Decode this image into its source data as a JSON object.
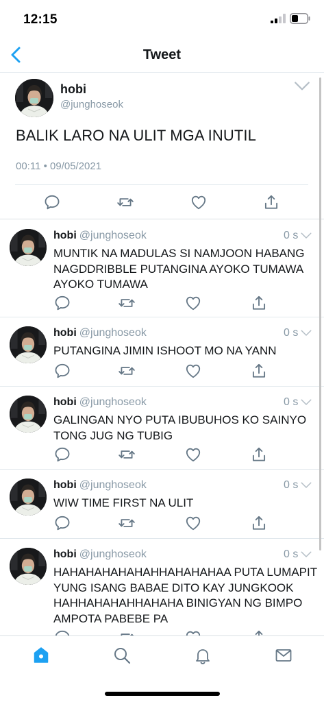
{
  "status_bar": {
    "time": "12:15"
  },
  "nav": {
    "title": "Tweet"
  },
  "main_tweet": {
    "name": "hobi",
    "handle": "@junghoseok",
    "text": "BALIK LARO NA ULIT MGA INUTIL",
    "meta": "00:11 • 09/05/2021"
  },
  "replies": [
    {
      "name": "hobi",
      "handle": "@junghoseok",
      "time": "0 s",
      "text": "MUNTIK NA MADULAS SI NAMJOON HABANG NAGDDRIBBLE PUTANGINA AYOKO TUMAWA AYOKO TUMAWA"
    },
    {
      "name": "hobi",
      "handle": "@junghoseok",
      "time": "0 s",
      "text": "PUTANGINA JIMIN ISHOOT MO NA YANN"
    },
    {
      "name": "hobi",
      "handle": "@junghoseok",
      "time": "0 s",
      "text": "GALINGAN NYO PUTA IBUBUHOS KO SAINYO TONG JUG NG TUBIG"
    },
    {
      "name": "hobi",
      "handle": "@junghoseok",
      "time": "0 s",
      "text": "WIW TIME FIRST NA ULIT"
    },
    {
      "name": "hobi",
      "handle": "@junghoseok",
      "time": "0 s",
      "text": "HAHAHAHAHAHAHHAHAHAHAA PUTA LUMAPIT YUNG ISANG BABAE DITO KAY JUNGKOOK HAHHAHAHAHHAHAHA BINIGYAN NG BIMPO AMPOTA PABEBE PA"
    }
  ],
  "icons": {
    "reply": "reply-icon",
    "retweet": "retweet-icon",
    "like": "heart-icon",
    "share": "share-icon",
    "tabs": [
      "home-icon",
      "search-icon",
      "bell-icon",
      "mail-icon"
    ]
  },
  "colors": {
    "accent": "#1da1f2",
    "secondary_text": "#8899a6",
    "icon_gray": "#657786",
    "divider": "#e1e8ed"
  }
}
